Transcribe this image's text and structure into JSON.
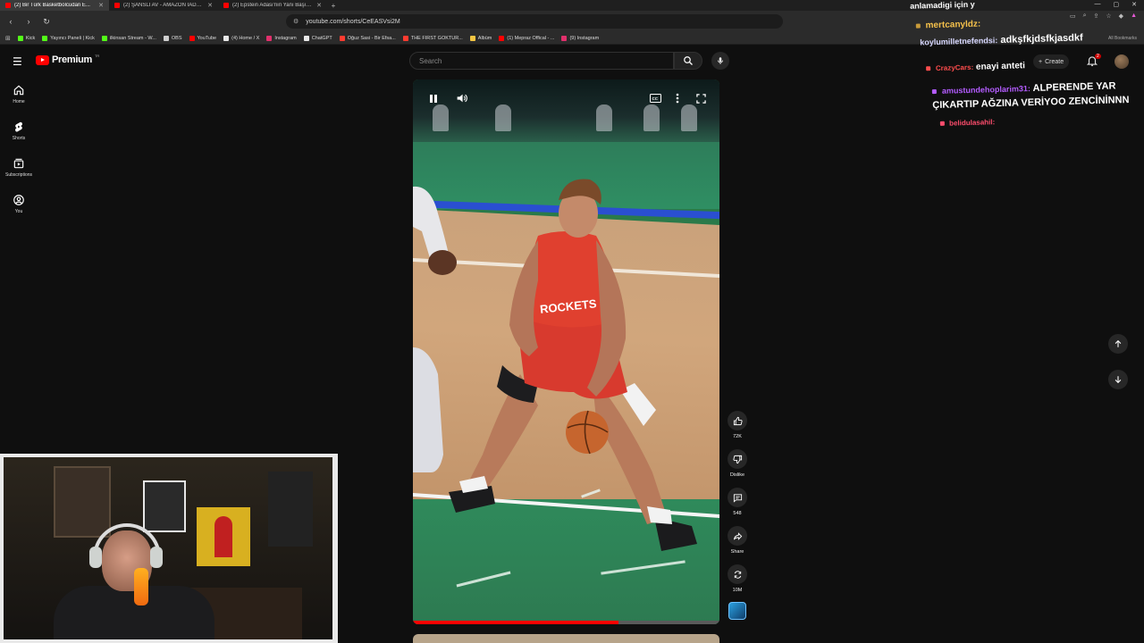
{
  "browser": {
    "tabs": [
      {
        "title": "(2) Bir Türk Basketbolcudan E...",
        "active": true
      },
      {
        "title": "(2) ŞANSLI AV - AMAZON İADE DEP...",
        "active": false
      },
      {
        "title": "(2) Epstein Adası'nın Yanı Başında Ya...",
        "active": false
      }
    ],
    "url": "youtube.com/shorts/CeEASVsi2M",
    "bookmarks": [
      {
        "label": "Kick",
        "color": "#53fc18"
      },
      {
        "label": "Yayıncı Paneli | Kick",
        "color": "#53fc18"
      },
      {
        "label": "ilkinsan Stream - W...",
        "color": "#53fc18"
      },
      {
        "label": "OBS",
        "color": "#cfcfcf"
      },
      {
        "label": "YouTube",
        "color": "#ff0000"
      },
      {
        "label": "(4) Home / X",
        "color": "#e8e8e8"
      },
      {
        "label": "Instagram",
        "color": "#e1306c"
      },
      {
        "label": "ChatGPT",
        "color": "#e8e8e8"
      },
      {
        "label": "Oğuz Sasi - Bir Efsa...",
        "color": "#ff3b30"
      },
      {
        "label": "THE FIRST GOKTUR...",
        "color": "#ff3b30"
      },
      {
        "label": "Albüm",
        "color": "#f4c542"
      },
      {
        "label": "(1) Mepraz Offical - ...",
        "color": "#ff0000"
      },
      {
        "label": "(9) Instagram",
        "color": "#e1306c"
      }
    ],
    "all_bookmarks": "All Bookmarks"
  },
  "youtube": {
    "logo_text": "Premium",
    "logo_tm": "TR",
    "search_placeholder": "Search",
    "create_label": "Create",
    "notification_badge": "2",
    "guide": [
      {
        "label": "Home",
        "icon": "home-icon"
      },
      {
        "label": "Shorts",
        "icon": "shorts-icon"
      },
      {
        "label": "Subscriptions",
        "icon": "subscriptions-icon"
      },
      {
        "label": "You",
        "icon": "you-icon"
      }
    ],
    "actions": [
      {
        "label": "72K",
        "icon": "like-icon"
      },
      {
        "label": "Dislike",
        "icon": "dislike-icon"
      },
      {
        "label": "548",
        "icon": "comment-icon"
      },
      {
        "label": "Share",
        "icon": "share-icon"
      },
      {
        "label": "10M",
        "icon": "remix-icon"
      }
    ],
    "progress": 0.67
  },
  "video": {
    "jersey_text": "ROCKETS"
  },
  "chat": [
    {
      "user": "anlamadigi için y",
      "msg": "",
      "color": "#ffffff"
    },
    {
      "user": "mertcanyldz:",
      "msg": "",
      "color": "#f5c14b"
    },
    {
      "user": "koylumilletnefendsi:",
      "msg": "adkşfkjdsfkjasdkf",
      "color": "#d7d7ff"
    },
    {
      "user": "CrazyCars:",
      "msg": "enayi anteti",
      "color": "#ff4d4d"
    },
    {
      "user": "amustundehoplarim31:",
      "msg": "ALPERENDE YAR",
      "color": "#b45cff"
    },
    {
      "user": "",
      "msg": "ÇIKARTIP AĞZINA VERİYOO ZENCİNİNNN",
      "color": "#ffffff"
    },
    {
      "user": "belidulasahil:",
      "msg": "",
      "color": "#ff4d6d"
    }
  ]
}
